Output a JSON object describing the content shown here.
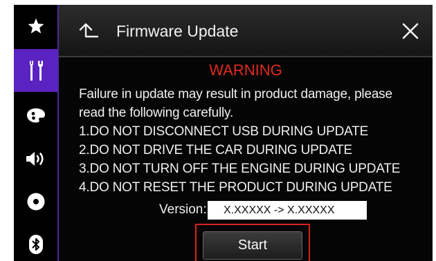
{
  "sidebar": {
    "items": [
      {
        "icon": "star-icon",
        "active": false
      },
      {
        "icon": "tools-icon",
        "active": true
      },
      {
        "icon": "theme-palette-icon",
        "active": false
      },
      {
        "icon": "speaker-icon",
        "active": false
      },
      {
        "icon": "disc-icon",
        "active": false
      },
      {
        "icon": "bluetooth-icon",
        "active": false
      }
    ],
    "accent_color": "#5b22c2"
  },
  "header": {
    "title": "Firmware Update",
    "back_icon": "back-arrow-icon",
    "close_icon": "close-icon"
  },
  "content": {
    "warning": "WARNING",
    "warning_color": "#e12a1f",
    "lines": [
      "Failure in update may result in product damage, please",
      "read the following carefully.",
      "1.DO NOT DISCONNECT USB DURING UPDATE",
      "2.DO NOT DRIVE THE CAR DURING UPDATE",
      "3.DO NOT TURN OFF THE ENGINE DURING UPDATE",
      "4.DO NOT RESET THE PRODUCT DURING UPDATE"
    ],
    "version_label": "Version:",
    "version_value": "X.XXXXX -> X.XXXXX",
    "start_label": "Start",
    "highlight_color": "#d9221c"
  }
}
